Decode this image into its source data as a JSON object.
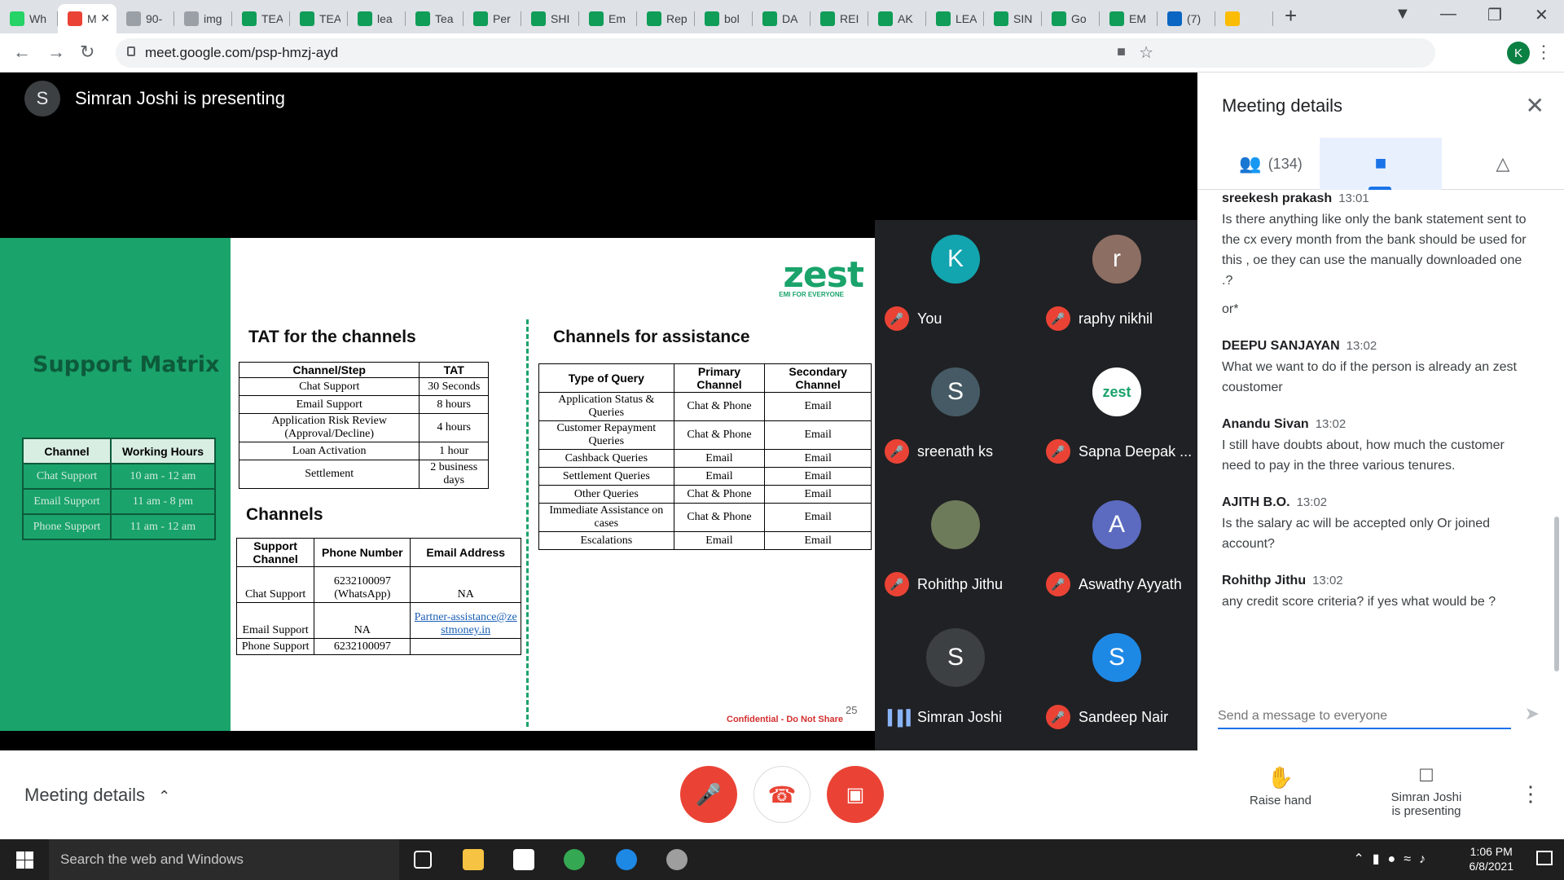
{
  "browser": {
    "tabs": [
      {
        "label": "Wh",
        "fav": "#25d366"
      },
      {
        "label": "M",
        "fav": "#ea4335",
        "active": true
      },
      {
        "label": "90-",
        "fav": "#9aa0a6"
      },
      {
        "label": "img",
        "fav": "#9aa0a6"
      },
      {
        "label": "TEA",
        "fav": "#0f9d58"
      },
      {
        "label": "TEA",
        "fav": "#0f9d58"
      },
      {
        "label": "lea",
        "fav": "#0f9d58"
      },
      {
        "label": "Tea",
        "fav": "#0f9d58"
      },
      {
        "label": "Per",
        "fav": "#0f9d58"
      },
      {
        "label": "SHI",
        "fav": "#0f9d58"
      },
      {
        "label": "Em",
        "fav": "#0f9d58"
      },
      {
        "label": "Rep",
        "fav": "#0f9d58"
      },
      {
        "label": "bol",
        "fav": "#0f9d58"
      },
      {
        "label": "DA",
        "fav": "#0f9d58"
      },
      {
        "label": "REI",
        "fav": "#0f9d58"
      },
      {
        "label": "AK",
        "fav": "#0f9d58"
      },
      {
        "label": "LEA",
        "fav": "#0f9d58"
      },
      {
        "label": "SIN",
        "fav": "#0f9d58"
      },
      {
        "label": "Go",
        "fav": "#0f9d58"
      },
      {
        "label": "EM",
        "fav": "#0f9d58"
      },
      {
        "label": "(7)",
        "fav": "#0a66c2"
      },
      {
        "label": "",
        "fav": "#fbbc04"
      }
    ],
    "url": "meet.google.com/psp-hmzj-ayd",
    "profile_initial": "K"
  },
  "meet": {
    "presenter_initial": "S",
    "presenting_text": "Simran Joshi is presenting",
    "slide": {
      "support_matrix_title": "Support Matrix",
      "hours_headers": [
        "Channel",
        "Working Hours"
      ],
      "hours_rows": [
        [
          "Chat Support",
          "10 am - 12 am"
        ],
        [
          "Email Support",
          "11 am - 8 pm"
        ],
        [
          "Phone Support",
          "11 am - 12 am"
        ]
      ],
      "logo_word": "zest",
      "logo_tagline": "EMI FOR EVERYONE",
      "tat_title": "TAT for the channels",
      "tat_headers": [
        "Channel/Step",
        "TAT"
      ],
      "tat_rows": [
        [
          "Chat Support",
          "30 Seconds"
        ],
        [
          "Email Support",
          "8 hours"
        ],
        [
          "Application Risk Review (Approval/Decline)",
          "4 hours"
        ],
        [
          "Loan Activation",
          "1 hour"
        ],
        [
          "Settlement",
          "2 business days"
        ]
      ],
      "channels_title": "Channels",
      "channels_headers": [
        "Support Channel",
        "Phone Number",
        "Email Address"
      ],
      "channels_rows": [
        [
          "Chat Support",
          "6232100097 (WhatsApp)",
          "NA"
        ],
        [
          "Email Support",
          "NA",
          "Partner-assistance@zestmoney.in"
        ],
        [
          "Phone Support",
          "6232100097",
          ""
        ]
      ],
      "assist_title": "Channels for assistance",
      "assist_headers": [
        "Type of Query",
        "Primary Channel",
        "Secondary Channel"
      ],
      "assist_rows": [
        [
          "Application Status & Queries",
          "Chat & Phone",
          "Email"
        ],
        [
          "Customer Repayment Queries",
          "Chat & Phone",
          "Email"
        ],
        [
          "Cashback Queries",
          "Email",
          "Email"
        ],
        [
          "Settlement Queries",
          "Email",
          "Email"
        ],
        [
          "Other Queries",
          "Chat & Phone",
          "Email"
        ],
        [
          "Immediate Assistance on cases",
          "Chat & Phone",
          "Email"
        ],
        [
          "Escalations",
          "Email",
          "Email"
        ]
      ],
      "confidential": "Confidential - Do Not Share",
      "page_number": "25"
    },
    "participants": [
      {
        "name": "You",
        "initial": "K",
        "color": "#12a4af",
        "muted": true
      },
      {
        "name": "raphy nikhil",
        "initial": "r",
        "color": "#8d6e63",
        "muted": true
      },
      {
        "name": "sreenath ks",
        "initial": "S",
        "color": "#455a64",
        "muted": true
      },
      {
        "name": "Sapna Deepak ...",
        "initial": "zest",
        "color": "#ffffff",
        "muted": true
      },
      {
        "name": "Rohithp Jithu",
        "initial": "",
        "color": "#6d7b5a",
        "muted": true
      },
      {
        "name": "Aswathy Ayyath",
        "initial": "A",
        "color": "#5c6bc0",
        "muted": true
      },
      {
        "name": "Simran Joshi",
        "initial": "S",
        "color": "#3c4043",
        "muted": false
      },
      {
        "name": "Sandeep Nair",
        "initial": "S",
        "color": "#1e88e5",
        "muted": true
      }
    ],
    "panel": {
      "title": "Meeting details",
      "people_count": "(134)",
      "messages": [
        {
          "author": "sreekesh prakash",
          "time": "13:01",
          "text": "Is there anything like only the bank statement sent to the cx every month from the bank should be used for this , oe they can use the manually downloaded one .?",
          "extra": "or*"
        },
        {
          "author": "DEEPU SANJAYAN",
          "time": "13:02",
          "text": "What we want to do if the person is already an zest coustomer"
        },
        {
          "author": "Anandu Sivan",
          "time": "13:02",
          "text": "I still have doubts about, how much the customer need to pay in the three various tenures."
        },
        {
          "author": "AJITH B.O.",
          "time": "13:02",
          "text": "Is the salary ac will be accepted only Or joined account?"
        },
        {
          "author": "Rohithp Jithu",
          "time": "13:02",
          "text": "any credit score criteria? if yes what would be ?"
        }
      ],
      "input_placeholder": "Send a message to everyone"
    },
    "bottom": {
      "details_label": "Meeting details",
      "raise_hand": "Raise hand",
      "presenting_line1": "Simran Joshi",
      "presenting_line2": "is presenting"
    }
  },
  "taskbar": {
    "search_placeholder": "Search the web and Windows",
    "time": "1:06 PM",
    "date": "6/8/2021"
  }
}
